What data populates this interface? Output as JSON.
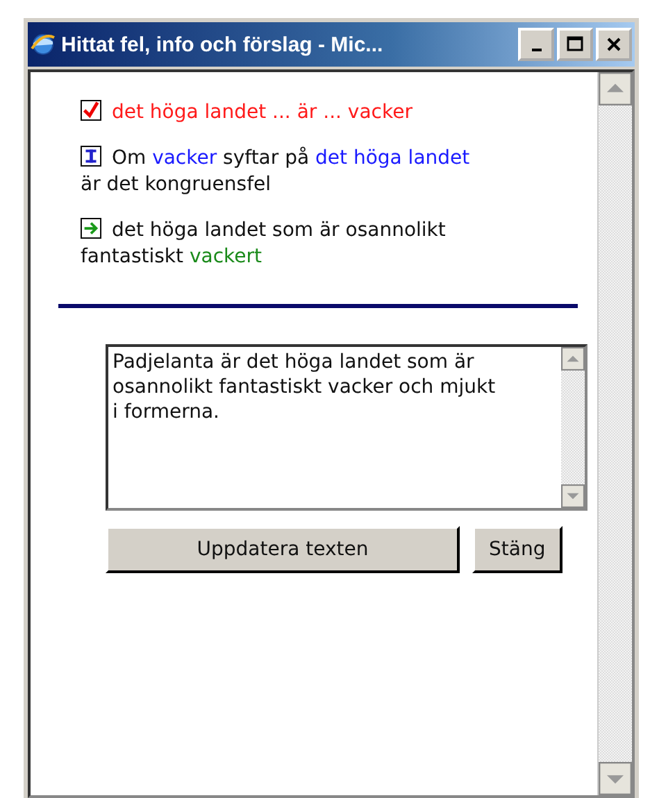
{
  "window": {
    "title": "Hittat fel, info och förslag - Mic..."
  },
  "messages": [
    {
      "kind": "error",
      "segments": [
        {
          "kind": "error",
          "text": "det höga landet ... är ... vacker"
        }
      ]
    },
    {
      "kind": "info",
      "segments": [
        {
          "kind": "plain",
          "text": "Om "
        },
        {
          "kind": "highlight",
          "text": "vacker"
        },
        {
          "kind": "plain",
          "text": " syftar på "
        },
        {
          "kind": "highlight",
          "text": "det höga landet"
        },
        {
          "kind": "plain",
          "text": " är det kongruensfel"
        }
      ]
    },
    {
      "kind": "suggestion",
      "segments": [
        {
          "kind": "plain",
          "text": "det höga landet som är osannolikt fantastiskt "
        },
        {
          "kind": "suggestion",
          "text": "vackert"
        }
      ]
    }
  ],
  "editor": {
    "value": "Padjelanta är det höga landet som är osannolikt fantastiskt vacker och mjukt i formerna."
  },
  "buttons": [
    {
      "label": "Uppdatera texten"
    },
    {
      "label": "Stäng"
    }
  ]
}
